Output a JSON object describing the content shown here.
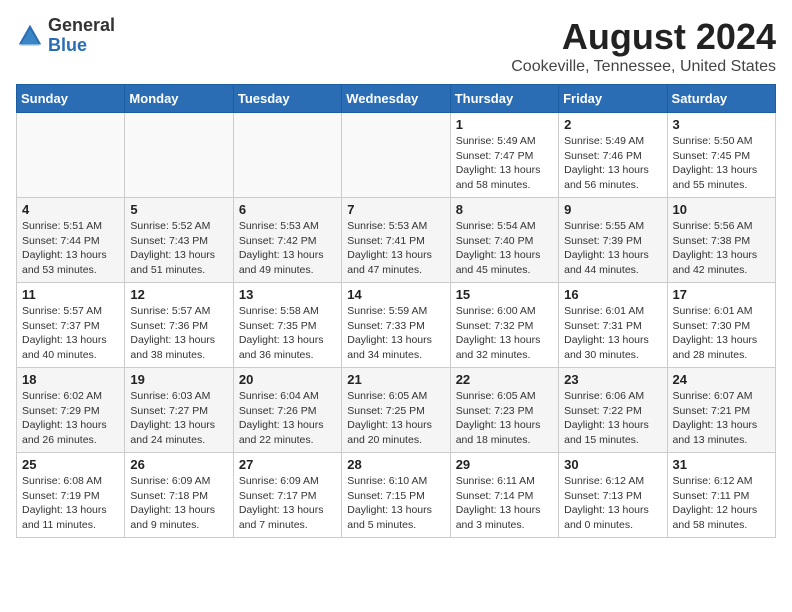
{
  "header": {
    "logo_general": "General",
    "logo_blue": "Blue",
    "title": "August 2024",
    "subtitle": "Cookeville, Tennessee, United States"
  },
  "calendar": {
    "weekdays": [
      "Sunday",
      "Monday",
      "Tuesday",
      "Wednesday",
      "Thursday",
      "Friday",
      "Saturday"
    ],
    "weeks": [
      [
        {
          "day": "",
          "info": ""
        },
        {
          "day": "",
          "info": ""
        },
        {
          "day": "",
          "info": ""
        },
        {
          "day": "",
          "info": ""
        },
        {
          "day": "1",
          "info": "Sunrise: 5:49 AM\nSunset: 7:47 PM\nDaylight: 13 hours\nand 58 minutes."
        },
        {
          "day": "2",
          "info": "Sunrise: 5:49 AM\nSunset: 7:46 PM\nDaylight: 13 hours\nand 56 minutes."
        },
        {
          "day": "3",
          "info": "Sunrise: 5:50 AM\nSunset: 7:45 PM\nDaylight: 13 hours\nand 55 minutes."
        }
      ],
      [
        {
          "day": "4",
          "info": "Sunrise: 5:51 AM\nSunset: 7:44 PM\nDaylight: 13 hours\nand 53 minutes."
        },
        {
          "day": "5",
          "info": "Sunrise: 5:52 AM\nSunset: 7:43 PM\nDaylight: 13 hours\nand 51 minutes."
        },
        {
          "day": "6",
          "info": "Sunrise: 5:53 AM\nSunset: 7:42 PM\nDaylight: 13 hours\nand 49 minutes."
        },
        {
          "day": "7",
          "info": "Sunrise: 5:53 AM\nSunset: 7:41 PM\nDaylight: 13 hours\nand 47 minutes."
        },
        {
          "day": "8",
          "info": "Sunrise: 5:54 AM\nSunset: 7:40 PM\nDaylight: 13 hours\nand 45 minutes."
        },
        {
          "day": "9",
          "info": "Sunrise: 5:55 AM\nSunset: 7:39 PM\nDaylight: 13 hours\nand 44 minutes."
        },
        {
          "day": "10",
          "info": "Sunrise: 5:56 AM\nSunset: 7:38 PM\nDaylight: 13 hours\nand 42 minutes."
        }
      ],
      [
        {
          "day": "11",
          "info": "Sunrise: 5:57 AM\nSunset: 7:37 PM\nDaylight: 13 hours\nand 40 minutes."
        },
        {
          "day": "12",
          "info": "Sunrise: 5:57 AM\nSunset: 7:36 PM\nDaylight: 13 hours\nand 38 minutes."
        },
        {
          "day": "13",
          "info": "Sunrise: 5:58 AM\nSunset: 7:35 PM\nDaylight: 13 hours\nand 36 minutes."
        },
        {
          "day": "14",
          "info": "Sunrise: 5:59 AM\nSunset: 7:33 PM\nDaylight: 13 hours\nand 34 minutes."
        },
        {
          "day": "15",
          "info": "Sunrise: 6:00 AM\nSunset: 7:32 PM\nDaylight: 13 hours\nand 32 minutes."
        },
        {
          "day": "16",
          "info": "Sunrise: 6:01 AM\nSunset: 7:31 PM\nDaylight: 13 hours\nand 30 minutes."
        },
        {
          "day": "17",
          "info": "Sunrise: 6:01 AM\nSunset: 7:30 PM\nDaylight: 13 hours\nand 28 minutes."
        }
      ],
      [
        {
          "day": "18",
          "info": "Sunrise: 6:02 AM\nSunset: 7:29 PM\nDaylight: 13 hours\nand 26 minutes."
        },
        {
          "day": "19",
          "info": "Sunrise: 6:03 AM\nSunset: 7:27 PM\nDaylight: 13 hours\nand 24 minutes."
        },
        {
          "day": "20",
          "info": "Sunrise: 6:04 AM\nSunset: 7:26 PM\nDaylight: 13 hours\nand 22 minutes."
        },
        {
          "day": "21",
          "info": "Sunrise: 6:05 AM\nSunset: 7:25 PM\nDaylight: 13 hours\nand 20 minutes."
        },
        {
          "day": "22",
          "info": "Sunrise: 6:05 AM\nSunset: 7:23 PM\nDaylight: 13 hours\nand 18 minutes."
        },
        {
          "day": "23",
          "info": "Sunrise: 6:06 AM\nSunset: 7:22 PM\nDaylight: 13 hours\nand 15 minutes."
        },
        {
          "day": "24",
          "info": "Sunrise: 6:07 AM\nSunset: 7:21 PM\nDaylight: 13 hours\nand 13 minutes."
        }
      ],
      [
        {
          "day": "25",
          "info": "Sunrise: 6:08 AM\nSunset: 7:19 PM\nDaylight: 13 hours\nand 11 minutes."
        },
        {
          "day": "26",
          "info": "Sunrise: 6:09 AM\nSunset: 7:18 PM\nDaylight: 13 hours\nand 9 minutes."
        },
        {
          "day": "27",
          "info": "Sunrise: 6:09 AM\nSunset: 7:17 PM\nDaylight: 13 hours\nand 7 minutes."
        },
        {
          "day": "28",
          "info": "Sunrise: 6:10 AM\nSunset: 7:15 PM\nDaylight: 13 hours\nand 5 minutes."
        },
        {
          "day": "29",
          "info": "Sunrise: 6:11 AM\nSunset: 7:14 PM\nDaylight: 13 hours\nand 3 minutes."
        },
        {
          "day": "30",
          "info": "Sunrise: 6:12 AM\nSunset: 7:13 PM\nDaylight: 13 hours\nand 0 minutes."
        },
        {
          "day": "31",
          "info": "Sunrise: 6:12 AM\nSunset: 7:11 PM\nDaylight: 12 hours\nand 58 minutes."
        }
      ]
    ]
  }
}
